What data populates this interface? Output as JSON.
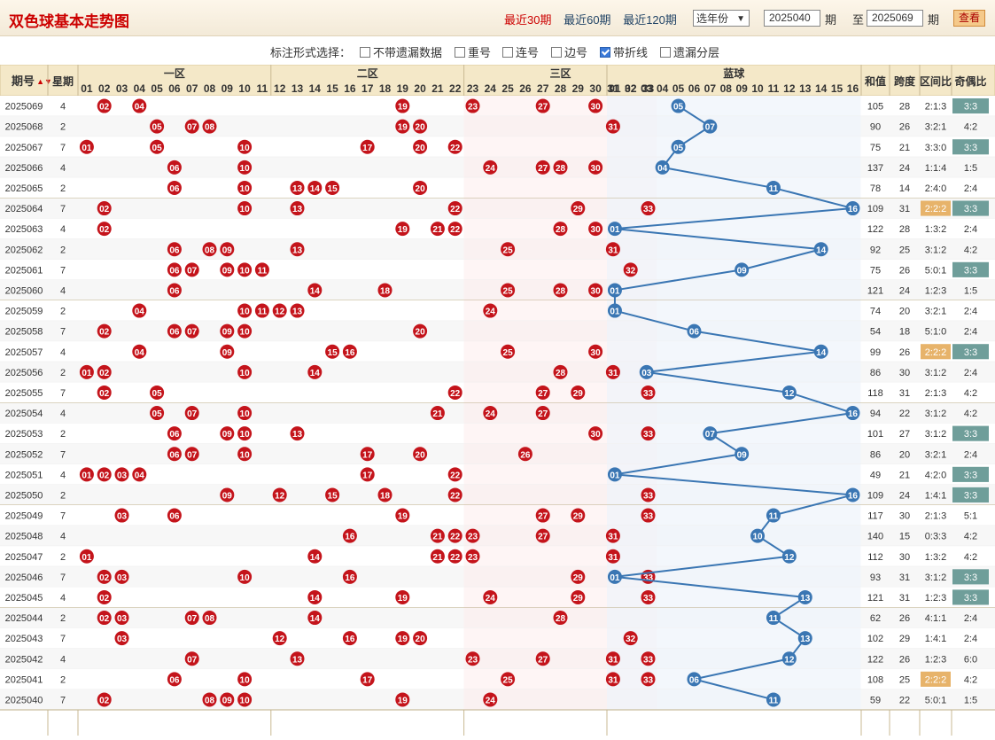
{
  "header": {
    "title": "双色球基本走势图",
    "links": [
      "最近30期",
      "最近60期",
      "最近120期"
    ],
    "year_select": "选年份",
    "from_value": "2025040",
    "unit1": "期",
    "to_label": "至",
    "to_value": "2025069",
    "unit2": "期",
    "view_button": "查看"
  },
  "options": {
    "label": "标注形式选择：",
    "items": [
      {
        "label": "不带遗漏数据",
        "checked": false
      },
      {
        "label": "重号",
        "checked": false
      },
      {
        "label": "连号",
        "checked": false
      },
      {
        "label": "边号",
        "checked": false
      },
      {
        "label": "带折线",
        "checked": true
      },
      {
        "label": "遗漏分层",
        "checked": false
      }
    ]
  },
  "table": {
    "col_period": "期号",
    "col_weekday": "星期",
    "zones": [
      "一区",
      "二区",
      "三区"
    ],
    "blue_label": "蓝球",
    "stat_headers": [
      "和值",
      "跨度",
      "区间比",
      "奇偶比"
    ],
    "rows": [
      {
        "p": "2025069",
        "w": "4",
        "r": [
          2,
          4,
          19,
          23,
          27,
          30
        ],
        "b": 5,
        "s": "105",
        "k": "28",
        "z": "2:1:3",
        "o": "3:3"
      },
      {
        "p": "2025068",
        "w": "2",
        "r": [
          5,
          7,
          8,
          19,
          20,
          31
        ],
        "b": 7,
        "s": "90",
        "k": "26",
        "z": "3:2:1",
        "o": "4:2"
      },
      {
        "p": "2025067",
        "w": "7",
        "r": [
          1,
          5,
          10,
          17,
          20,
          22
        ],
        "b": 5,
        "s": "75",
        "k": "21",
        "z": "3:3:0",
        "o": "3:3"
      },
      {
        "p": "2025066",
        "w": "4",
        "r": [
          6,
          10,
          24,
          27,
          28,
          30
        ],
        "b": 4,
        "s": "137",
        "k": "24",
        "z": "1:1:4",
        "o": "1:5"
      },
      {
        "p": "2025065",
        "w": "2",
        "r": [
          6,
          10,
          13,
          14,
          15,
          20
        ],
        "b": 11,
        "s": "78",
        "k": "14",
        "z": "2:4:0",
        "o": "2:4"
      },
      {
        "p": "2025064",
        "w": "7",
        "r": [
          2,
          10,
          13,
          22,
          29,
          33
        ],
        "b": 16,
        "s": "109",
        "k": "31",
        "z": "2:2:2",
        "o": "3:3"
      },
      {
        "p": "2025063",
        "w": "4",
        "r": [
          2,
          19,
          21,
          22,
          28,
          30
        ],
        "b": 1,
        "s": "122",
        "k": "28",
        "z": "1:3:2",
        "o": "2:4"
      },
      {
        "p": "2025062",
        "w": "2",
        "r": [
          6,
          8,
          9,
          13,
          25,
          31
        ],
        "b": 14,
        "s": "92",
        "k": "25",
        "z": "3:1:2",
        "o": "4:2"
      },
      {
        "p": "2025061",
        "w": "7",
        "r": [
          6,
          7,
          9,
          10,
          11,
          32
        ],
        "b": 9,
        "s": "75",
        "k": "26",
        "z": "5:0:1",
        "o": "3:3"
      },
      {
        "p": "2025060",
        "w": "4",
        "r": [
          6,
          14,
          18,
          25,
          28,
          30
        ],
        "b": 1,
        "s": "121",
        "k": "24",
        "z": "1:2:3",
        "o": "1:5"
      },
      {
        "p": "2025059",
        "w": "2",
        "r": [
          4,
          10,
          11,
          12,
          13,
          24
        ],
        "b": 1,
        "s": "74",
        "k": "20",
        "z": "3:2:1",
        "o": "2:4"
      },
      {
        "p": "2025058",
        "w": "7",
        "r": [
          2,
          6,
          7,
          9,
          10,
          20
        ],
        "b": 6,
        "s": "54",
        "k": "18",
        "z": "5:1:0",
        "o": "2:4"
      },
      {
        "p": "2025057",
        "w": "4",
        "r": [
          4,
          9,
          15,
          16,
          25,
          30
        ],
        "b": 14,
        "s": "99",
        "k": "26",
        "z": "2:2:2",
        "o": "3:3"
      },
      {
        "p": "2025056",
        "w": "2",
        "r": [
          1,
          2,
          10,
          14,
          28,
          31
        ],
        "b": 3,
        "s": "86",
        "k": "30",
        "z": "3:1:2",
        "o": "2:4"
      },
      {
        "p": "2025055",
        "w": "7",
        "r": [
          2,
          5,
          22,
          27,
          29,
          33
        ],
        "b": 12,
        "s": "118",
        "k": "31",
        "z": "2:1:3",
        "o": "4:2"
      },
      {
        "p": "2025054",
        "w": "4",
        "r": [
          5,
          7,
          10,
          21,
          24,
          27
        ],
        "b": 16,
        "s": "94",
        "k": "22",
        "z": "3:1:2",
        "o": "4:2"
      },
      {
        "p": "2025053",
        "w": "2",
        "r": [
          6,
          9,
          10,
          13,
          30,
          33
        ],
        "b": 7,
        "s": "101",
        "k": "27",
        "z": "3:1:2",
        "o": "3:3"
      },
      {
        "p": "2025052",
        "w": "7",
        "r": [
          6,
          7,
          10,
          17,
          20,
          26
        ],
        "b": 9,
        "s": "86",
        "k": "20",
        "z": "3:2:1",
        "o": "2:4"
      },
      {
        "p": "2025051",
        "w": "4",
        "r": [
          1,
          2,
          3,
          4,
          17,
          22
        ],
        "b": 1,
        "s": "49",
        "k": "21",
        "z": "4:2:0",
        "o": "3:3"
      },
      {
        "p": "2025050",
        "w": "2",
        "r": [
          9,
          12,
          15,
          18,
          22,
          33
        ],
        "b": 16,
        "s": "109",
        "k": "24",
        "z": "1:4:1",
        "o": "3:3"
      },
      {
        "p": "2025049",
        "w": "7",
        "r": [
          3,
          6,
          19,
          27,
          29,
          33
        ],
        "b": 11,
        "s": "117",
        "k": "30",
        "z": "2:1:3",
        "o": "5:1"
      },
      {
        "p": "2025048",
        "w": "4",
        "r": [
          16,
          21,
          22,
          23,
          27,
          31
        ],
        "b": 10,
        "s": "140",
        "k": "15",
        "z": "0:3:3",
        "o": "4:2"
      },
      {
        "p": "2025047",
        "w": "2",
        "r": [
          1,
          14,
          21,
          22,
          23,
          31
        ],
        "b": 12,
        "s": "112",
        "k": "30",
        "z": "1:3:2",
        "o": "4:2"
      },
      {
        "p": "2025046",
        "w": "7",
        "r": [
          2,
          3,
          10,
          16,
          29,
          33
        ],
        "b": 1,
        "s": "93",
        "k": "31",
        "z": "3:1:2",
        "o": "3:3"
      },
      {
        "p": "2025045",
        "w": "4",
        "r": [
          2,
          14,
          19,
          24,
          29,
          33
        ],
        "b": 13,
        "s": "121",
        "k": "31",
        "z": "1:2:3",
        "o": "3:3"
      },
      {
        "p": "2025044",
        "w": "2",
        "r": [
          2,
          3,
          7,
          8,
          14,
          28
        ],
        "b": 11,
        "s": "62",
        "k": "26",
        "z": "4:1:1",
        "o": "2:4"
      },
      {
        "p": "2025043",
        "w": "7",
        "r": [
          3,
          12,
          16,
          19,
          20,
          32
        ],
        "b": 13,
        "s": "102",
        "k": "29",
        "z": "1:4:1",
        "o": "2:4"
      },
      {
        "p": "2025042",
        "w": "4",
        "r": [
          7,
          13,
          23,
          27,
          31,
          33
        ],
        "b": 12,
        "s": "122",
        "k": "26",
        "z": "1:2:3",
        "o": "6:0"
      },
      {
        "p": "2025041",
        "w": "2",
        "r": [
          6,
          10,
          17,
          25,
          31,
          33
        ],
        "b": 6,
        "s": "108",
        "k": "25",
        "z": "2:2:2",
        "o": "4:2"
      },
      {
        "p": "2025040",
        "w": "7",
        "r": [
          2,
          8,
          9,
          10,
          19,
          24
        ],
        "b": 11,
        "s": "59",
        "k": "22",
        "z": "5:0:1",
        "o": "1:5"
      }
    ]
  },
  "colors": {
    "red_ball": "#c4141b",
    "blue_ball": "#3a76b3",
    "teal_badge": "#6f9e9a",
    "orange_badge": "#e7b36a",
    "line": "#3a76b3"
  }
}
